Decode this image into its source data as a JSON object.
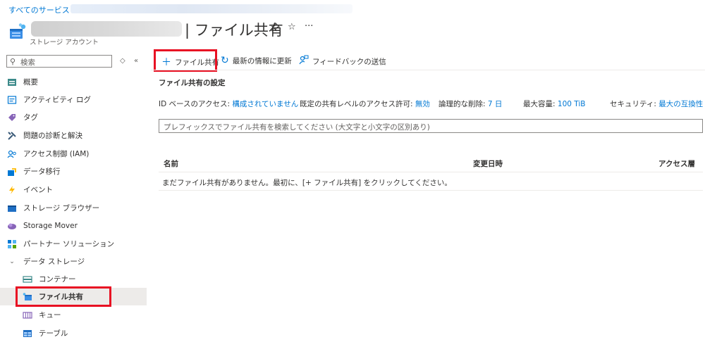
{
  "breadcrumb": {
    "root": "すべてのサービス",
    "separator": "›"
  },
  "header": {
    "title": "| ファイル共有",
    "subtitle": "ストレージ アカウント",
    "more": "···"
  },
  "sidebar": {
    "search_placeholder": "検索",
    "items": [
      {
        "label": "概要",
        "icon": "overview-icon"
      },
      {
        "label": "アクティビティ ログ",
        "icon": "activity-log-icon"
      },
      {
        "label": "タグ",
        "icon": "tag-icon"
      },
      {
        "label": "問題の診断と解決",
        "icon": "diagnose-icon"
      },
      {
        "label": "アクセス制御 (IAM)",
        "icon": "iam-icon"
      },
      {
        "label": "データ移行",
        "icon": "data-migration-icon"
      },
      {
        "label": "イベント",
        "icon": "events-icon"
      },
      {
        "label": "ストレージ ブラウザー",
        "icon": "storage-browser-icon"
      },
      {
        "label": "Storage Mover",
        "icon": "storage-mover-icon"
      },
      {
        "label": "パートナー ソリューション",
        "icon": "partner-icon"
      },
      {
        "label": "データ ストレージ",
        "icon": "chevron-down-icon"
      },
      {
        "label": "コンテナー",
        "icon": "container-icon"
      },
      {
        "label": "ファイル共有",
        "icon": "file-share-icon"
      },
      {
        "label": "キュー",
        "icon": "queue-icon"
      },
      {
        "label": "テーブル",
        "icon": "table-icon"
      }
    ],
    "selected": "ファイル共有"
  },
  "toolbar": {
    "add_label": "ファイル共有",
    "refresh_label": "最新の情報に更新",
    "feedback_label": "フィードバックの送信"
  },
  "settings": {
    "title": "ファイル共有の設定",
    "props": [
      {
        "label": "ID ベースのアクセス:",
        "value": "構成されていません"
      },
      {
        "label": "既定の共有レベルのアクセス許可:",
        "value": "無効"
      },
      {
        "label": "論理的な削除:",
        "value": "7 日"
      },
      {
        "label": "最大容量:",
        "value": "100 TiB"
      },
      {
        "label": "セキュリティ:",
        "value": "最大の互換性"
      }
    ]
  },
  "filter": {
    "placeholder": "プレフィックスでファイル共有を検索してください (大文字と小文字の区別あり)"
  },
  "table": {
    "columns": [
      "名前",
      "変更日時",
      "アクセス層"
    ],
    "empty_message": "まだファイル共有がありません。最初に、[+ ファイル共有] をクリックしてください。"
  },
  "colors": {
    "accent": "#0078d4",
    "highlight": "#e81123",
    "selected_bg": "#edebe9"
  }
}
